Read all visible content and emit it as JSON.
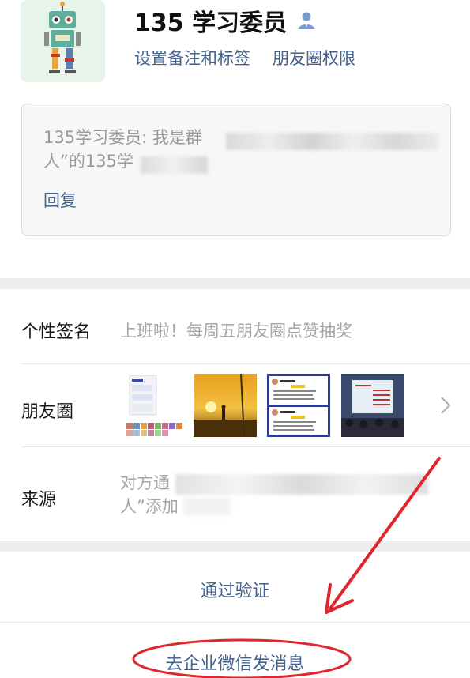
{
  "profile": {
    "name": "135 学习委员",
    "avatar_icon": "robot-avatar",
    "user_icon": "contact-person-icon",
    "links": [
      "设置备注和标签",
      "朋友圈权限"
    ]
  },
  "message": {
    "line1": "135学习委员: 我是群",
    "line2": "人”的135学",
    "reply_label": "回复"
  },
  "signature": {
    "label": "个性签名",
    "value": "上班啦！每周五朋友圈点赞抽奖"
  },
  "moments": {
    "label": "朋友圈",
    "thumbnail_icons": [
      "chat-screenshot-thumb",
      "sunset-photo-thumb",
      "article-card-thumb",
      "classroom-photo-thumb"
    ],
    "chevron_icon": "chevron-right-icon"
  },
  "source": {
    "label": "来源",
    "line1": "对方通",
    "line2": "人”添加"
  },
  "actions": {
    "verify_label": "通过验证",
    "message_label": "去企业微信发消息"
  },
  "annotation": {
    "color": "#e0262d"
  }
}
